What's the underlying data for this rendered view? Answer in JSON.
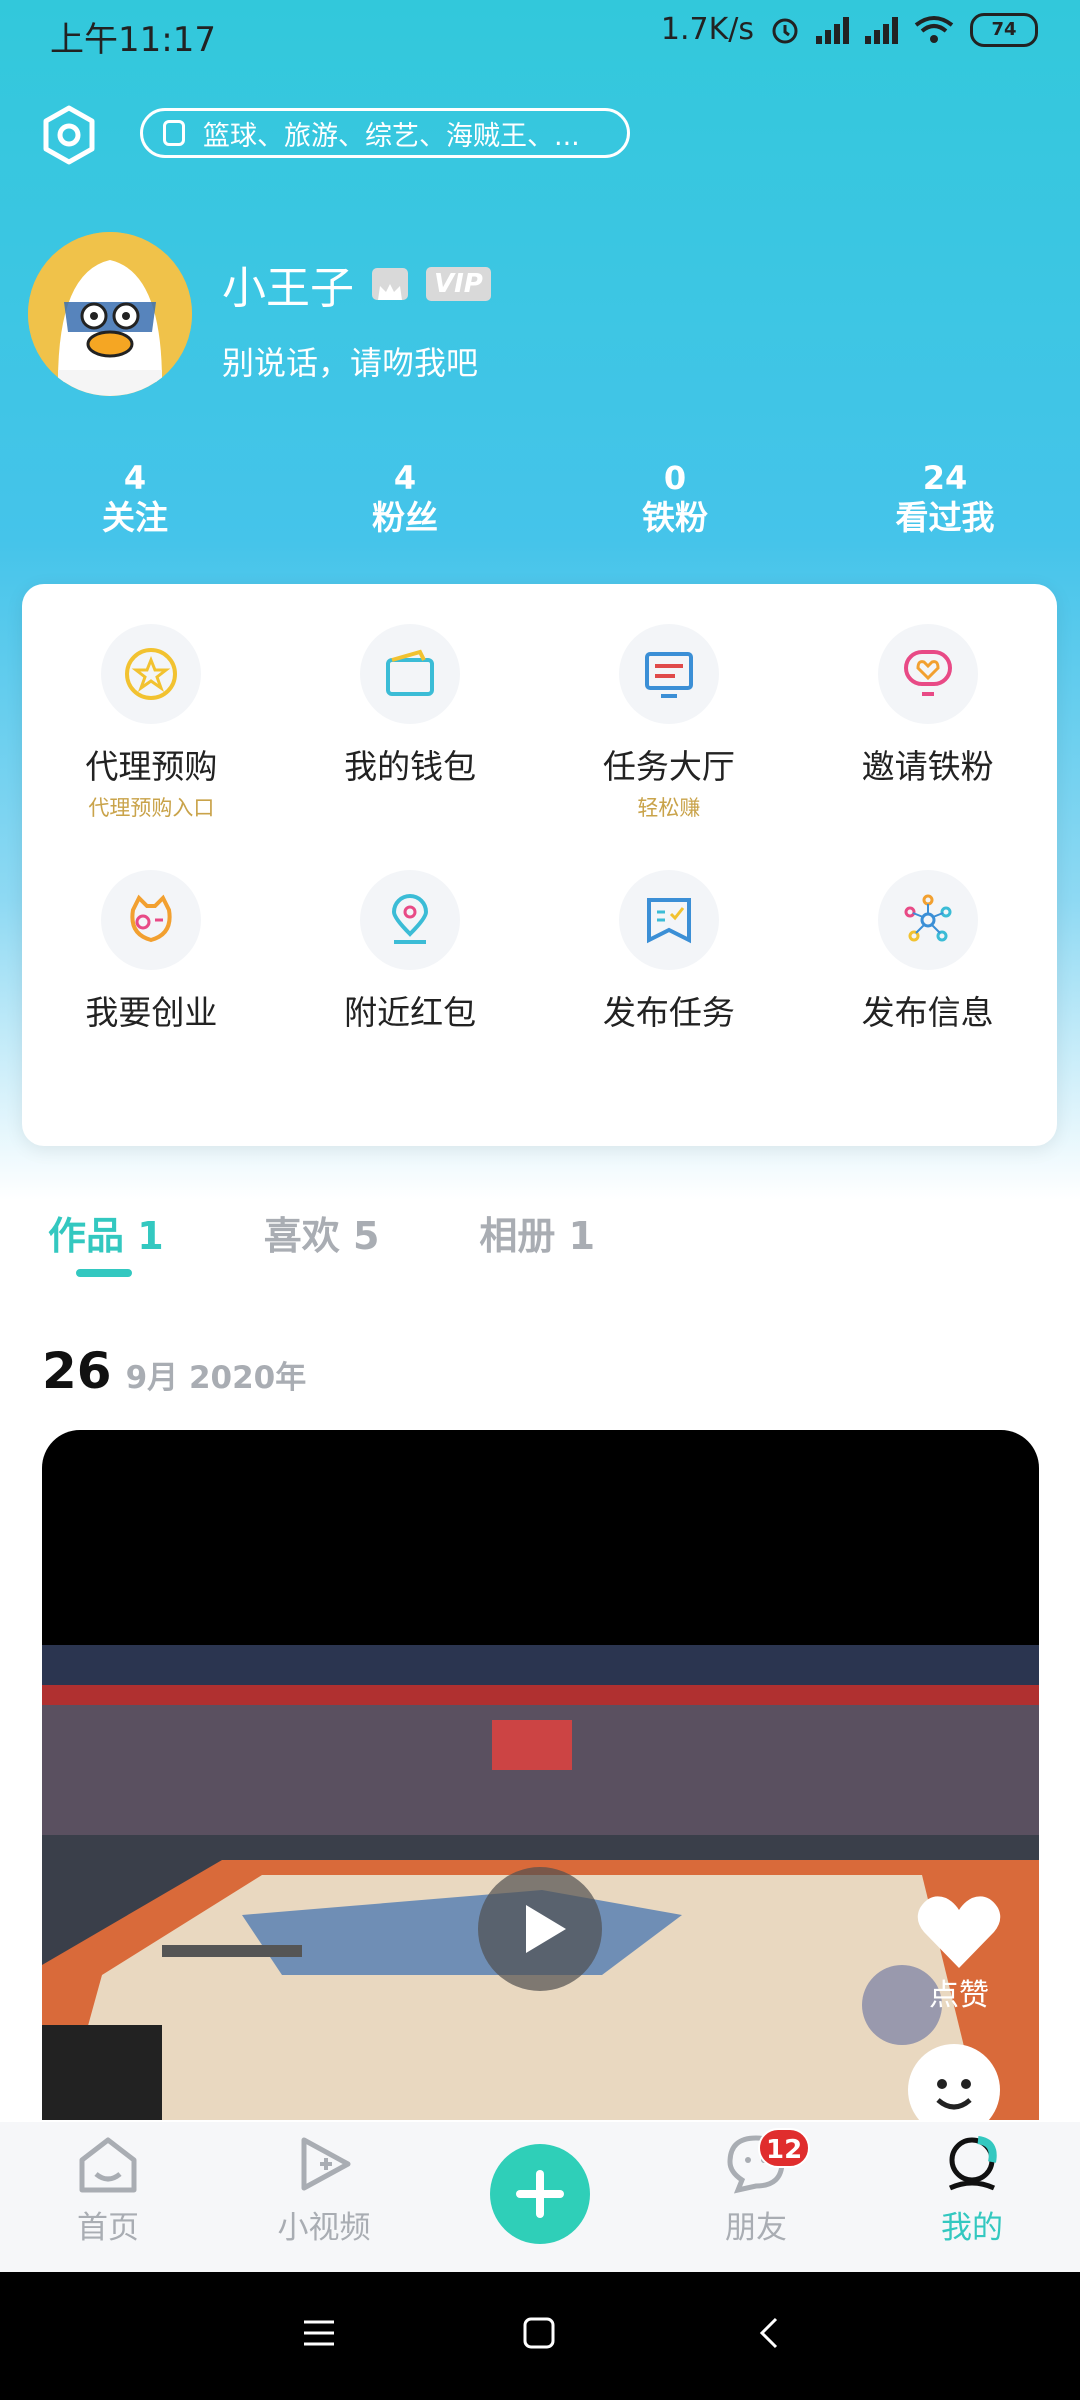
{
  "status_bar": {
    "time": "上午11:17",
    "net_speed": "1.7K/s",
    "battery": "74"
  },
  "search": {
    "placeholder_text": "篮球、旅游、综艺、海贼王、..."
  },
  "profile": {
    "name": "小王子",
    "vip_label": "VIP",
    "signature": "别说话，请吻我吧"
  },
  "stats": [
    {
      "count": "4",
      "label": "关注"
    },
    {
      "count": "4",
      "label": "粉丝"
    },
    {
      "count": "0",
      "label": "铁粉"
    },
    {
      "count": "24",
      "label": "看过我"
    }
  ],
  "features": [
    {
      "label": "代理预购",
      "sub": "代理预购入口",
      "icon": "star-coin-icon"
    },
    {
      "label": "我的钱包",
      "sub": "",
      "icon": "wallet-icon"
    },
    {
      "label": "任务大厅",
      "sub": "轻松赚",
      "icon": "monitor-icon"
    },
    {
      "label": "邀请铁粉",
      "sub": "",
      "icon": "heart-mirror-icon"
    },
    {
      "label": "我要创业",
      "sub": "",
      "icon": "mascot-face-icon"
    },
    {
      "label": "附近红包",
      "sub": "",
      "icon": "location-pin-icon"
    },
    {
      "label": "发布任务",
      "sub": "",
      "icon": "checklist-flag-icon"
    },
    {
      "label": "发布信息",
      "sub": "",
      "icon": "network-nodes-icon"
    }
  ],
  "tabs": [
    {
      "label": "作品",
      "count": "1"
    },
    {
      "label": "喜欢",
      "count": "5"
    },
    {
      "label": "相册",
      "count": "1"
    }
  ],
  "post": {
    "day": "26",
    "month_year": "9月 2020年",
    "like_label": "点赞"
  },
  "bottom_nav": [
    {
      "label": "首页",
      "icon": "home-icon"
    },
    {
      "label": "小视频",
      "icon": "video-play-icon"
    },
    {
      "label": "",
      "icon": "add-icon"
    },
    {
      "label": "朋友",
      "icon": "friends-chat-icon"
    },
    {
      "label": "我的",
      "icon": "me-icon"
    }
  ],
  "friends_badge": "12",
  "colors": {
    "accent": "#33c8c0",
    "header_top": "#32c8db",
    "badge_red": "#e02d2d",
    "gold_sub": "#c9a34a"
  }
}
